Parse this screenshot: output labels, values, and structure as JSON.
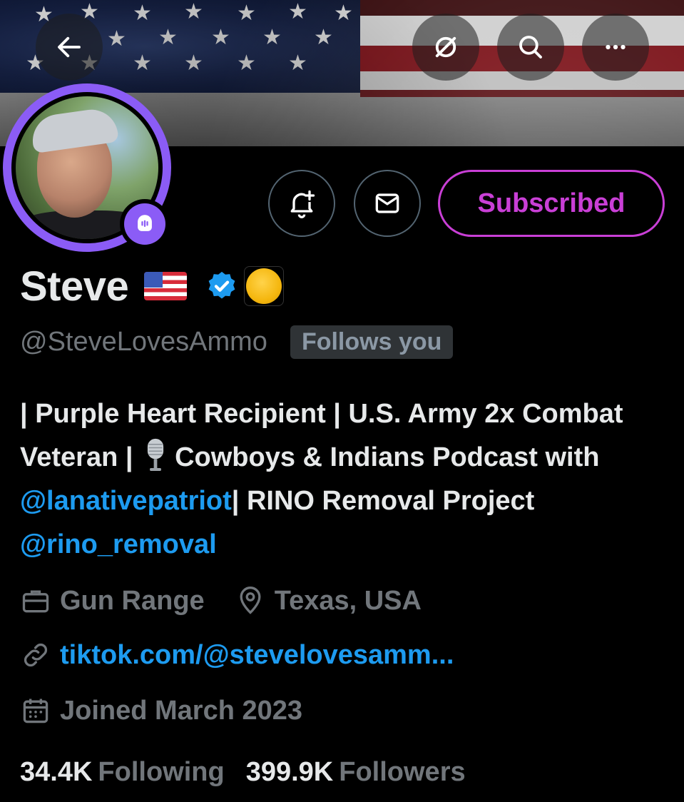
{
  "header": {
    "back_icon": "arrow-left-icon",
    "grok_icon": "grok-icon",
    "search_icon": "search-icon",
    "more_icon": "more-horizontal-icon"
  },
  "profile": {
    "display_name": "Steve",
    "handle": "@SteveLovesAmmo",
    "follows_you": "Follows you",
    "subscribe_label": "Subscribed",
    "bio": {
      "part1": "| Purple Heart Recipient | U.S. Army 2x Combat Veteran |",
      "part2": "Cowboys & Indians Podcast with",
      "mention1": "@lanativepatriot",
      "part3": "| RINO Removal Project",
      "mention2": "@rino_removal"
    },
    "category": "Gun Range",
    "location": "Texas, USA",
    "website": "tiktok.com/@stevelovesamm...",
    "joined": "Joined March 2023"
  },
  "stats": {
    "following_count": "34.4K",
    "following_label": "Following",
    "followers_count": "399.9K",
    "followers_label": "Followers"
  },
  "colors": {
    "accent_blue": "#1d9bf0",
    "subscribed_magenta": "#c93fd6",
    "avatar_ring_purple": "#8b5cf6",
    "muted_gray": "#71767b"
  }
}
